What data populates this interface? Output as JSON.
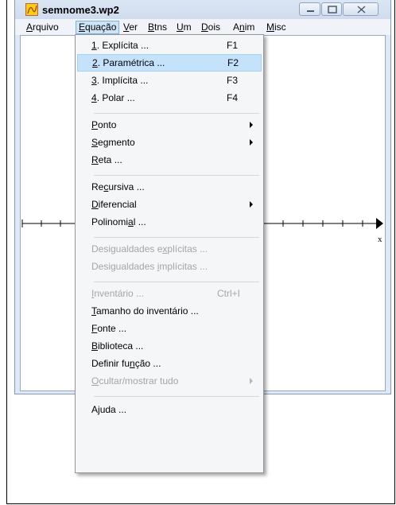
{
  "window": {
    "title": "semnome3.wp2"
  },
  "menubar": {
    "items": [
      {
        "pre": "",
        "u": "A",
        "post": "rquivo"
      },
      {
        "pre": "",
        "u": "E",
        "post": "quação"
      },
      {
        "pre": "",
        "u": "V",
        "post": "er"
      },
      {
        "pre": "",
        "u": "B",
        "post": "tns"
      },
      {
        "pre": "",
        "u": "U",
        "post": "m"
      },
      {
        "pre": "",
        "u": "D",
        "post": "ois"
      },
      {
        "pre": "A",
        "u": "n",
        "post": "im"
      },
      {
        "pre": "",
        "u": "M",
        "post": "isc"
      }
    ]
  },
  "dropdown": {
    "items": [
      {
        "pre": "",
        "u": "1",
        "post": ". Explícita ...",
        "shortcut": "F1"
      },
      {
        "pre": "",
        "u": "2",
        "post": ". Paramétrica ...",
        "shortcut": "F2"
      },
      {
        "pre": "",
        "u": "3",
        "post": ". Implícita ...",
        "shortcut": "F3"
      },
      {
        "pre": "",
        "u": "4",
        "post": ". Polar ...",
        "shortcut": "F4"
      },
      {
        "pre": "",
        "u": "P",
        "post": "onto"
      },
      {
        "pre": "",
        "u": "S",
        "post": "egmento"
      },
      {
        "pre": "",
        "u": "R",
        "post": "eta ..."
      },
      {
        "pre": "Re",
        "u": "c",
        "post": "ursiva ..."
      },
      {
        "pre": "",
        "u": "D",
        "post": "iferencial"
      },
      {
        "pre": "Polinomi",
        "u": "a",
        "post": "l ..."
      },
      {
        "pre": "Desigualdades e",
        "u": "x",
        "post": "plícitas ..."
      },
      {
        "pre": "Desigualdades ",
        "u": "i",
        "post": "mplícitas ..."
      },
      {
        "pre": "",
        "u": "I",
        "post": "nventário ...",
        "shortcut": "Ctrl+I"
      },
      {
        "pre": "",
        "u": "T",
        "post": "amanho do inventário ..."
      },
      {
        "pre": "",
        "u": "F",
        "post": "onte ..."
      },
      {
        "pre": "",
        "u": "B",
        "post": "iblioteca ..."
      },
      {
        "pre": "Definir fu",
        "u": "n",
        "post": "ção ..."
      },
      {
        "pre": "",
        "u": "O",
        "post": "cultar/mostrar tudo"
      },
      {
        "pre": "A",
        "u": "j",
        "post": "uda ..."
      }
    ]
  },
  "canvas": {
    "axis_label": "x"
  },
  "colors": {
    "highlight": "#c4e3fb",
    "disabled_text": "#a5a5a5",
    "title_bg": "#dbe6f4"
  }
}
